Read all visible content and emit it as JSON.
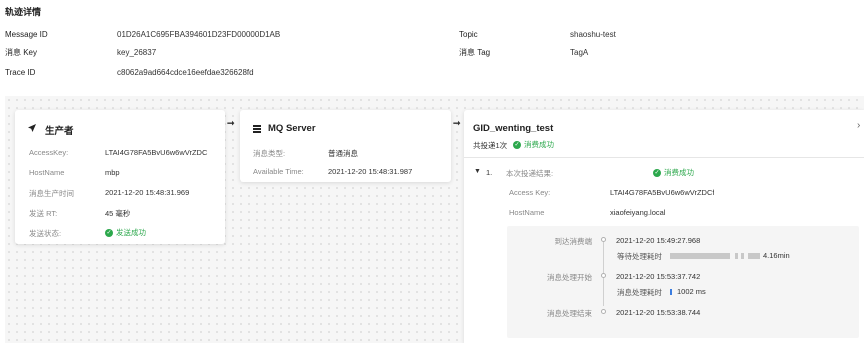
{
  "page_title": "轨迹详情",
  "info": {
    "message_id_label": "Message ID",
    "message_id_value": "01D26A1C695FBA394601D23FD00000D1AB",
    "topic_label": "Topic",
    "topic_value": "shaoshu-test",
    "message_key_label": "消息 Key",
    "message_key_value": "key_26837",
    "message_tag_label": "消息 Tag",
    "message_tag_value": "TagA",
    "trace_id_label": "Trace ID",
    "trace_id_value": "c8062a9ad664cdce16eefdae326628fd"
  },
  "producer": {
    "title": "生产者",
    "icon": "send-icon",
    "access_key_label": "AccessKey:",
    "access_key_value": "LTAI4G78FA5BvU6w6wVrZDC",
    "hostname_label": "HostName",
    "hostname_value": "mbp",
    "produce_time_label": "消息生产时间",
    "produce_time_value": "2021-12-20 15:48:31.969",
    "rt_label": "发送 RT:",
    "rt_value": "45 毫秒",
    "status_label": "发送状态:",
    "status_value": "发送成功"
  },
  "mq_server": {
    "title": "MQ Server",
    "icon": "server-icon",
    "type_label": "消息类型:",
    "type_value": "普通消息",
    "available_label": "Available Time:",
    "available_value": "2021-12-20 15:48:31.987"
  },
  "consumer": {
    "title": "GID_wenting_test",
    "delivery_count": "共投递1次",
    "delivery_status": "消费成功",
    "item_index": "1.",
    "result_label": "本次投递结果:",
    "result_value": "消费成功",
    "access_key_label": "Access Key:",
    "access_key_value": "LTAI4G78FA5BvU6w6wVrZDCf",
    "hostname_label": "HostName",
    "hostname_value": "xiaofeiyang.local",
    "timeline": {
      "arrive_label": "到达消费端",
      "arrive_time": "2021-12-20 15:49:27.968",
      "wait_label": "等待处理耗时",
      "wait_value": "4.16min",
      "start_label": "消息处理开始",
      "start_time": "2021-12-20 15:53:37.742",
      "process_label": "消息处理耗时",
      "process_value": "1002 ms",
      "end_label": "消息处理结束",
      "end_time": "2021-12-20 15:53:38.744"
    }
  },
  "colors": {
    "success": "#2ca84c",
    "accent_blue": "#3b7de0"
  }
}
